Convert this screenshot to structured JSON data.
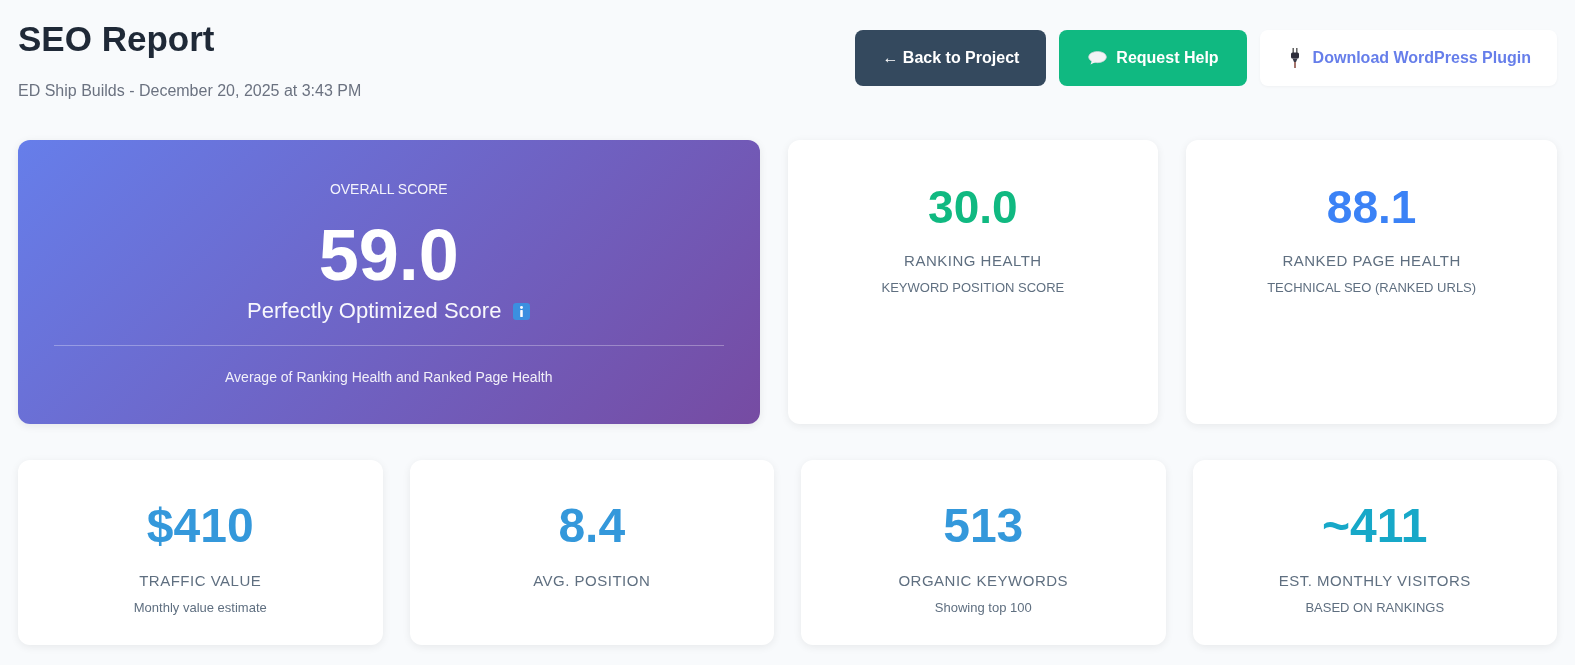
{
  "header": {
    "title": "SEO Report",
    "subtitle": "ED Ship Builds - December 20, 2025 at 3:43 PM"
  },
  "actions": [
    {
      "label": "← Back to Project",
      "kind": "back"
    },
    {
      "label": "Request Help",
      "kind": "help"
    },
    {
      "label": "Download WordPress Plugin",
      "kind": "plugin"
    }
  ],
  "overall": {
    "label": "OVERALL SCORE",
    "value": "59.0",
    "caption": "Perfectly Optimized Score",
    "note": "Average of Ranking Health and Ranked Page Health"
  },
  "scores": [
    {
      "value": "30.0",
      "label": "RANKING HEALTH",
      "sublabel": "KEYWORD POSITION SCORE",
      "color": "#10b981"
    },
    {
      "value": "88.1",
      "label": "RANKED PAGE HEALTH",
      "sublabel": "TECHNICAL SEO (RANKED URLS)",
      "color": "#3b82f6"
    }
  ],
  "metrics": [
    {
      "value": "$410",
      "label": "TRAFFIC VALUE",
      "sublabel": "Monthly value estimate",
      "color": "#3498db"
    },
    {
      "value": "8.4",
      "label": "AVG. POSITION",
      "color": "#3498db"
    },
    {
      "value": "513",
      "label": "ORGANIC KEYWORDS",
      "sublabel": "Showing top 100",
      "color": "#3498db"
    },
    {
      "value": "~411",
      "label": "EST. MONTHLY VISITORS",
      "sublabel": "BASED ON RANKINGS",
      "color": "#17a8c8"
    }
  ]
}
